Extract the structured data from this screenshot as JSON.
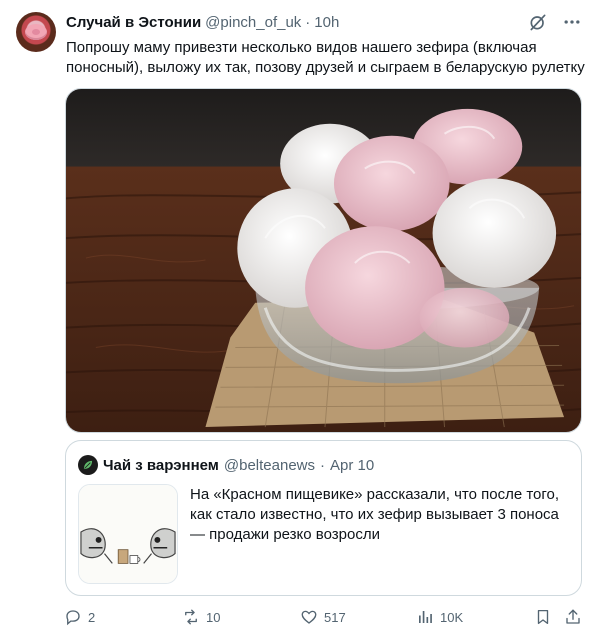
{
  "post": {
    "author_name": "Случай в Эстонии",
    "author_handle": "@pinch_of_uk",
    "separator": "·",
    "time": "10h",
    "text": "Попрошу маму привезти несколько видов нашего зефира (включая поносный), выложу их так, позову друзей и сыграем в беларускую рулетку",
    "icons": {
      "grok": "grok-icon",
      "more": "more-icon"
    }
  },
  "quote": {
    "author_name": "Чай з варэннем",
    "author_handle": "@belteanews",
    "separator": "·",
    "time": "Apr 10",
    "text": "На «Красном пищевике» рассказали, что после того, как стало известно, что их зефир вызывает 3 поноса — продажи резко возросли"
  },
  "actions": {
    "replies": "2",
    "reposts": "10",
    "likes": "517",
    "views": "10K"
  },
  "colors": {
    "text": "#0f1419",
    "muted": "#536471",
    "border": "#cfd9de"
  }
}
